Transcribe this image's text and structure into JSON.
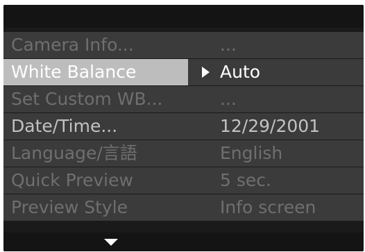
{
  "menu": {
    "items": [
      {
        "label": "Camera Info...",
        "value": "...",
        "state": "disabled"
      },
      {
        "label": "White Balance",
        "value": "Auto",
        "state": "selected"
      },
      {
        "label": "Set Custom WB...",
        "value": "...",
        "state": "disabled"
      },
      {
        "label": "Date/Time...",
        "value": "12/29/2001",
        "state": "enabled"
      },
      {
        "label": "Language/言語",
        "value": "English",
        "state": "disabled"
      },
      {
        "label": "Quick Preview",
        "value": "5 sec.",
        "state": "disabled"
      },
      {
        "label": "Preview Style",
        "value": "Info screen",
        "state": "disabled"
      }
    ]
  },
  "icons": {
    "selection_marker": "arrow-right-icon",
    "scroll_indicator": "scroll-down-icon"
  },
  "colors": {
    "background": "#1a1a1a",
    "row_background": "#3b3b3b",
    "selected_highlight": "#bdbdbd",
    "text_enabled": "#c2c2c2",
    "text_disabled": "#6f6f6f",
    "text_selected": "#ffffff"
  }
}
